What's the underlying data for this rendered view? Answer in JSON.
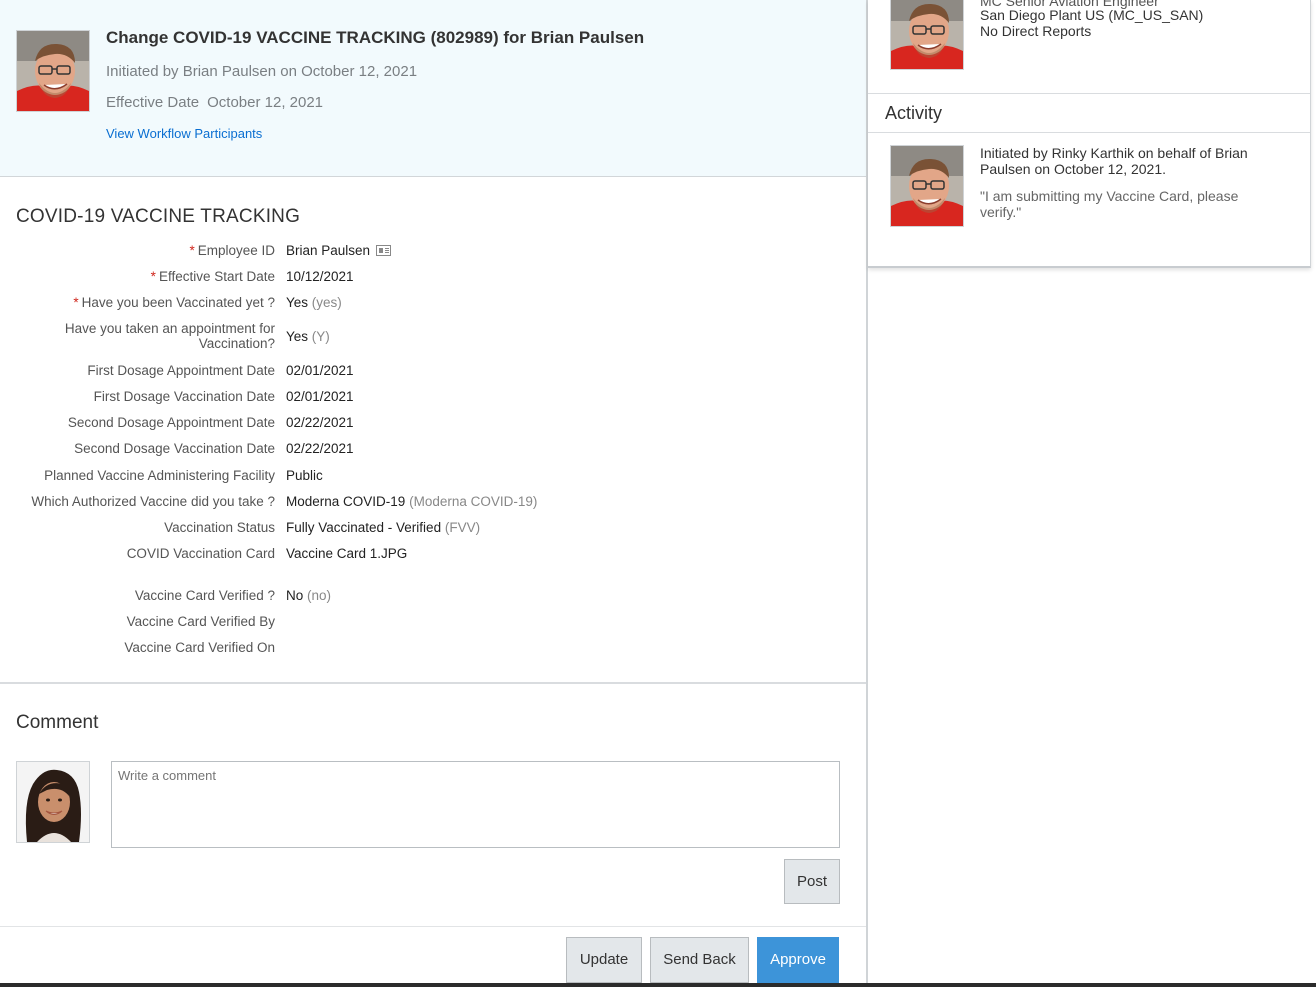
{
  "header": {
    "title": "Change COVID-19 VACCINE TRACKING (802989) for Brian Paulsen",
    "initiated": "Initiated by Brian Paulsen on October 12, 2021",
    "effective_label": "Effective Date",
    "effective_value": "October 12, 2021",
    "workflow_link": "View Workflow Participants"
  },
  "form": {
    "title": "COVID-19 VACCINE TRACKING",
    "rows": [
      {
        "label": "Employee ID",
        "value": "Brian Paulsen",
        "code": "",
        "required": true
      },
      {
        "label": "Effective Start Date",
        "value": "10/12/2021",
        "code": "",
        "required": true
      },
      {
        "label": "Have you been Vaccinated yet ?",
        "value": "Yes",
        "code": "(yes)",
        "required": true
      },
      {
        "label_l1": "Have you taken an appointment for",
        "label_l2": "Vaccination?",
        "value": "Yes",
        "code": "(Y)"
      },
      {
        "label": "First Dosage Appointment Date",
        "value": "02/01/2021"
      },
      {
        "label": "First Dosage Vaccination Date",
        "value": "02/01/2021"
      },
      {
        "label": "Second Dosage Appointment Date",
        "value": "02/22/2021"
      },
      {
        "label": "Second Dosage Vaccination Date",
        "value": "02/22/2021"
      },
      {
        "label": "Planned Vaccine Administering Facility",
        "value": "Public"
      },
      {
        "label": "Which Authorized Vaccine did you take ?",
        "value": "Moderna COVID-19",
        "code": "(Moderna COVID-19)"
      },
      {
        "label": "Vaccination Status",
        "value": "Fully Vaccinated - Verified",
        "code": "(FVV)"
      },
      {
        "label": "COVID Vaccination Card",
        "value": "Vaccine Card 1.JPG"
      },
      {
        "label": "Vaccine Card Verified ?",
        "value": "No",
        "code": "(no)"
      },
      {
        "label": "Vaccine Card Verified By",
        "value": ""
      },
      {
        "label": "Vaccine Card Verified On",
        "value": ""
      }
    ]
  },
  "comment": {
    "title": "Comment",
    "placeholder": "Write a comment",
    "post_label": "Post"
  },
  "actions": {
    "update": "Update",
    "send_back": "Send Back",
    "approve": "Approve"
  },
  "profile": {
    "role": "MC Senior Aviation Engineer",
    "plant": "San Diego Plant US (MC_US_SAN)",
    "reports": "No Direct Reports"
  },
  "activity": {
    "title": "Activity",
    "text": "Initiated by Rinky Karthik on behalf of Brian Paulsen on October 12, 2021.",
    "quote": "\"I am submitting my Vaccine Card, please verify.\""
  },
  "colors": {
    "header_bg": "#f2fafd",
    "link": "#0a6ed1",
    "required": "#d0271d",
    "approve": "#3d94d9"
  }
}
